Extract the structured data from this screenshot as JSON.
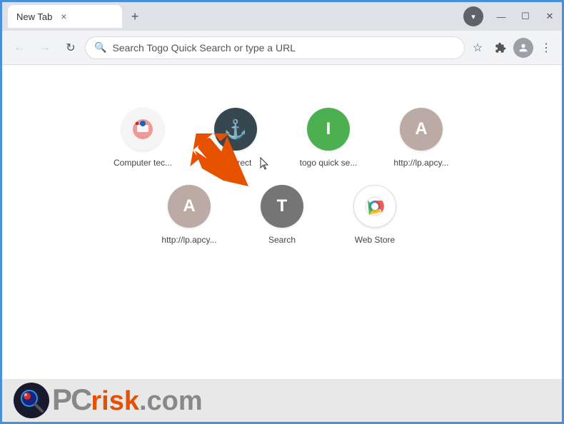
{
  "window": {
    "title": "New Tab",
    "close_label": "×",
    "new_tab_label": "+"
  },
  "window_controls": {
    "minimize": "—",
    "maximize": "☐",
    "close": "✕",
    "menu_icon": "▾"
  },
  "nav": {
    "back_label": "←",
    "forward_label": "→",
    "reload_label": "↻",
    "address_placeholder": "Search Togo Quick Search or type a URL",
    "star_label": "☆",
    "ext_label": "⚙",
    "more_label": "⋮"
  },
  "shortcuts": {
    "row1": [
      {
        "id": "computer-tec",
        "label": "Computer tec...",
        "icon_text": "",
        "icon_class": "icon-computer-tec",
        "color": "#f5f5f5"
      },
      {
        "id": "redirect",
        "label": "Redirect",
        "icon_text": "⚓",
        "icon_class": "icon-redirect",
        "color": "#37474f"
      },
      {
        "id": "togo",
        "label": "togo quick se...",
        "icon_text": "I",
        "icon_class": "icon-togo",
        "color": "#4caf50"
      },
      {
        "id": "http-a1",
        "label": "http://lp.apcy...",
        "icon_text": "A",
        "icon_class": "icon-http-a1",
        "color": "#bcaaa4"
      }
    ],
    "row2": [
      {
        "id": "http-a2",
        "label": "http://lp.apcy...",
        "icon_text": "A",
        "icon_class": "icon-http-a2",
        "color": "#bcaaa4"
      },
      {
        "id": "search",
        "label": "Search",
        "icon_text": "T",
        "icon_class": "icon-search",
        "color": "#757575"
      },
      {
        "id": "webstore",
        "label": "Web Store",
        "icon_text": "",
        "icon_class": "icon-webstore",
        "color": "#fff"
      }
    ]
  },
  "pcrisk": {
    "text_pc": "PC",
    "text_risk": "risk",
    "text_dotcom": ".com"
  }
}
